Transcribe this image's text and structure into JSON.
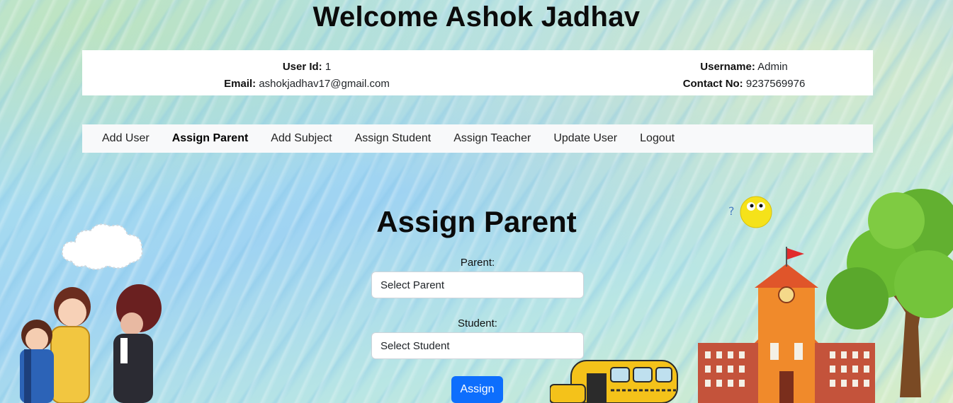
{
  "header": {
    "welcome_text": "Welcome Ashok Jadhav"
  },
  "user_info": {
    "user_id_label": "User Id:",
    "user_id_value": "1",
    "email_label": "Email:",
    "email_value": "ashokjadhav17@gmail.com",
    "username_label": "Username:",
    "username_value": "Admin",
    "contact_label": "Contact No:",
    "contact_value": "9237569976"
  },
  "nav": {
    "items": [
      {
        "label": "Add User",
        "active": false
      },
      {
        "label": "Assign Parent",
        "active": true
      },
      {
        "label": "Add Subject",
        "active": false
      },
      {
        "label": "Assign Student",
        "active": false
      },
      {
        "label": "Assign Teacher",
        "active": false
      },
      {
        "label": "Update User",
        "active": false
      },
      {
        "label": "Logout",
        "active": false
      }
    ]
  },
  "form": {
    "title": "Assign Parent",
    "parent_label": "Parent:",
    "parent_selected": "Select Parent",
    "student_label": "Student:",
    "student_selected": "Select Student",
    "submit_label": "Assign"
  },
  "colors": {
    "primary_button": "#0d6efd",
    "navbar_bg": "#f8f9fa",
    "card_bg": "#ffffff"
  }
}
